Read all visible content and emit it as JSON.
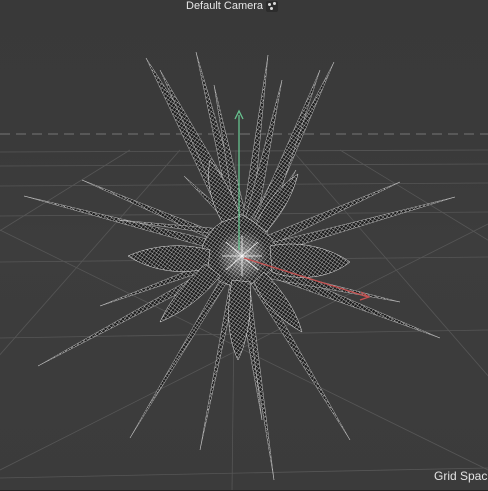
{
  "viewport": {
    "camera_label": "Default Camera",
    "camera_icon": "camera-orbit-icon",
    "grid_spacing_label": "Grid Spacin",
    "axis_colors": {
      "y_axis": "#67c28f",
      "x_axis": "#c65252"
    },
    "background_color": "#3b3b3b",
    "model": "spiky-star-wireframe-mesh"
  }
}
